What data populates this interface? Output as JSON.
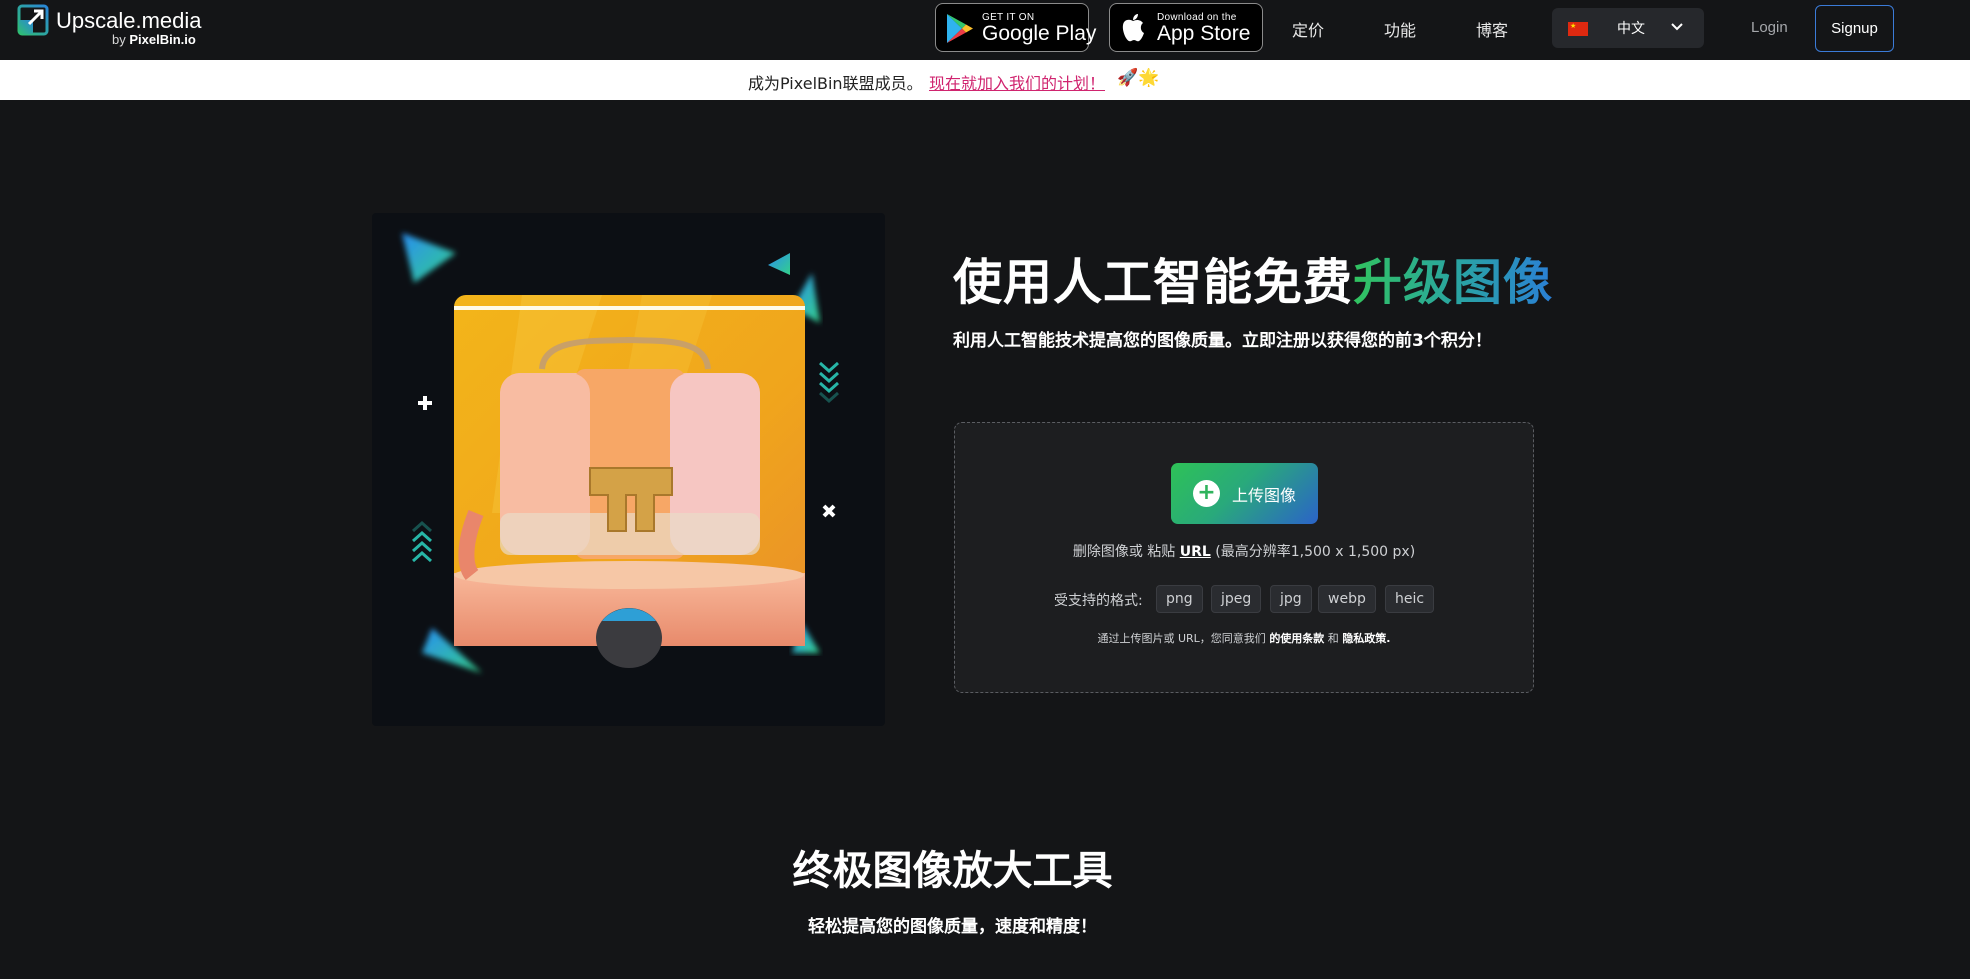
{
  "header": {
    "logo": {
      "name": "Upscale.media",
      "by_prefix": "by",
      "by_brand": "PixelBin.io"
    },
    "google_play": {
      "small": "GET IT ON",
      "big": "Google Play",
      "icon": "google-play-icon"
    },
    "app_store": {
      "small": "Download on the",
      "big": "App Store",
      "icon": "apple-icon"
    },
    "nav": [
      "定价",
      "功能",
      "博客"
    ],
    "language": {
      "label": "中文",
      "flag": "china-flag-icon"
    },
    "login": "Login",
    "signup": "Signup"
  },
  "banner": {
    "text": "成为PixelBin联盟成员。",
    "link": "现在就加入我们的计划！",
    "emoji": "🚀🌟"
  },
  "hero": {
    "headline_plain": "使用人工智能免费",
    "headline_highlight": "升级图像",
    "subheadline": "利用人工智能技术提高您的图像质量。立即注册以获得您的前3个积分！"
  },
  "upload": {
    "button": "上传图像",
    "paste_prefix": "删除图像或 粘贴 ",
    "paste_link": "URL",
    "paste_suffix": " (最高分辨率1,500 x 1,500 px)",
    "formats_label": "受支持的格式:",
    "formats": [
      "png",
      "jpeg",
      "jpg",
      "webp",
      "heic"
    ],
    "terms_prefix": "通过上传图片或 URL，您同意我们 ",
    "terms_link": "的使用条款",
    "terms_and": " 和 ",
    "privacy_link": "隐私政策."
  },
  "section": {
    "title": "终极图像放大工具",
    "subtitle": "轻松提高您的图像质量，速度和精度！"
  },
  "colors": {
    "background": "#141517",
    "accent_green": "#31c35f",
    "accent_blue": "#2a7fd6",
    "banner_link": "#d0246f",
    "signup_border": "#3b7bd8"
  }
}
